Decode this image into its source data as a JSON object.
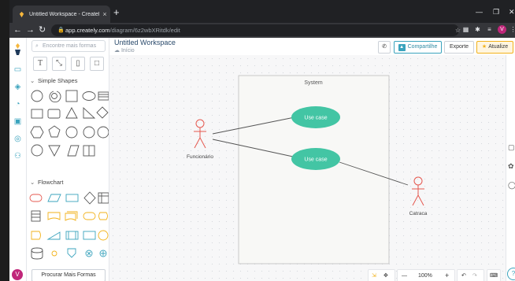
{
  "browser": {
    "tab_title": "Untitled Workspace - Creately",
    "tab_close": "×",
    "new_tab": "+",
    "url_host": "app.creately.com",
    "url_path": "/diagram/6z2wbXRitdk/edit",
    "profile_initial": "V"
  },
  "panel": {
    "search_placeholder": "Encontre mais formas",
    "categories": [
      "Simple Shapes",
      "Flowchart"
    ],
    "more_shapes": "Procurar Mais Formas"
  },
  "header": {
    "title": "Untitled Workspace",
    "subtitle": "Início",
    "share": "Compartilhe",
    "export": "Exporte",
    "upgrade": "Atualize"
  },
  "diagram": {
    "system_label": "System",
    "actor1": "Funcionário",
    "actor2": "Catraca",
    "usecase1": "Use case",
    "usecase2": "Use case"
  },
  "zoom": {
    "level": "100%",
    "minus": "—",
    "plus": "+"
  },
  "user": {
    "initial": "V"
  },
  "colors": {
    "usecase": "#43c5a4",
    "actor": "#e5584f",
    "accent": "#3aa3bd",
    "upgrade": "#f2b21b"
  }
}
